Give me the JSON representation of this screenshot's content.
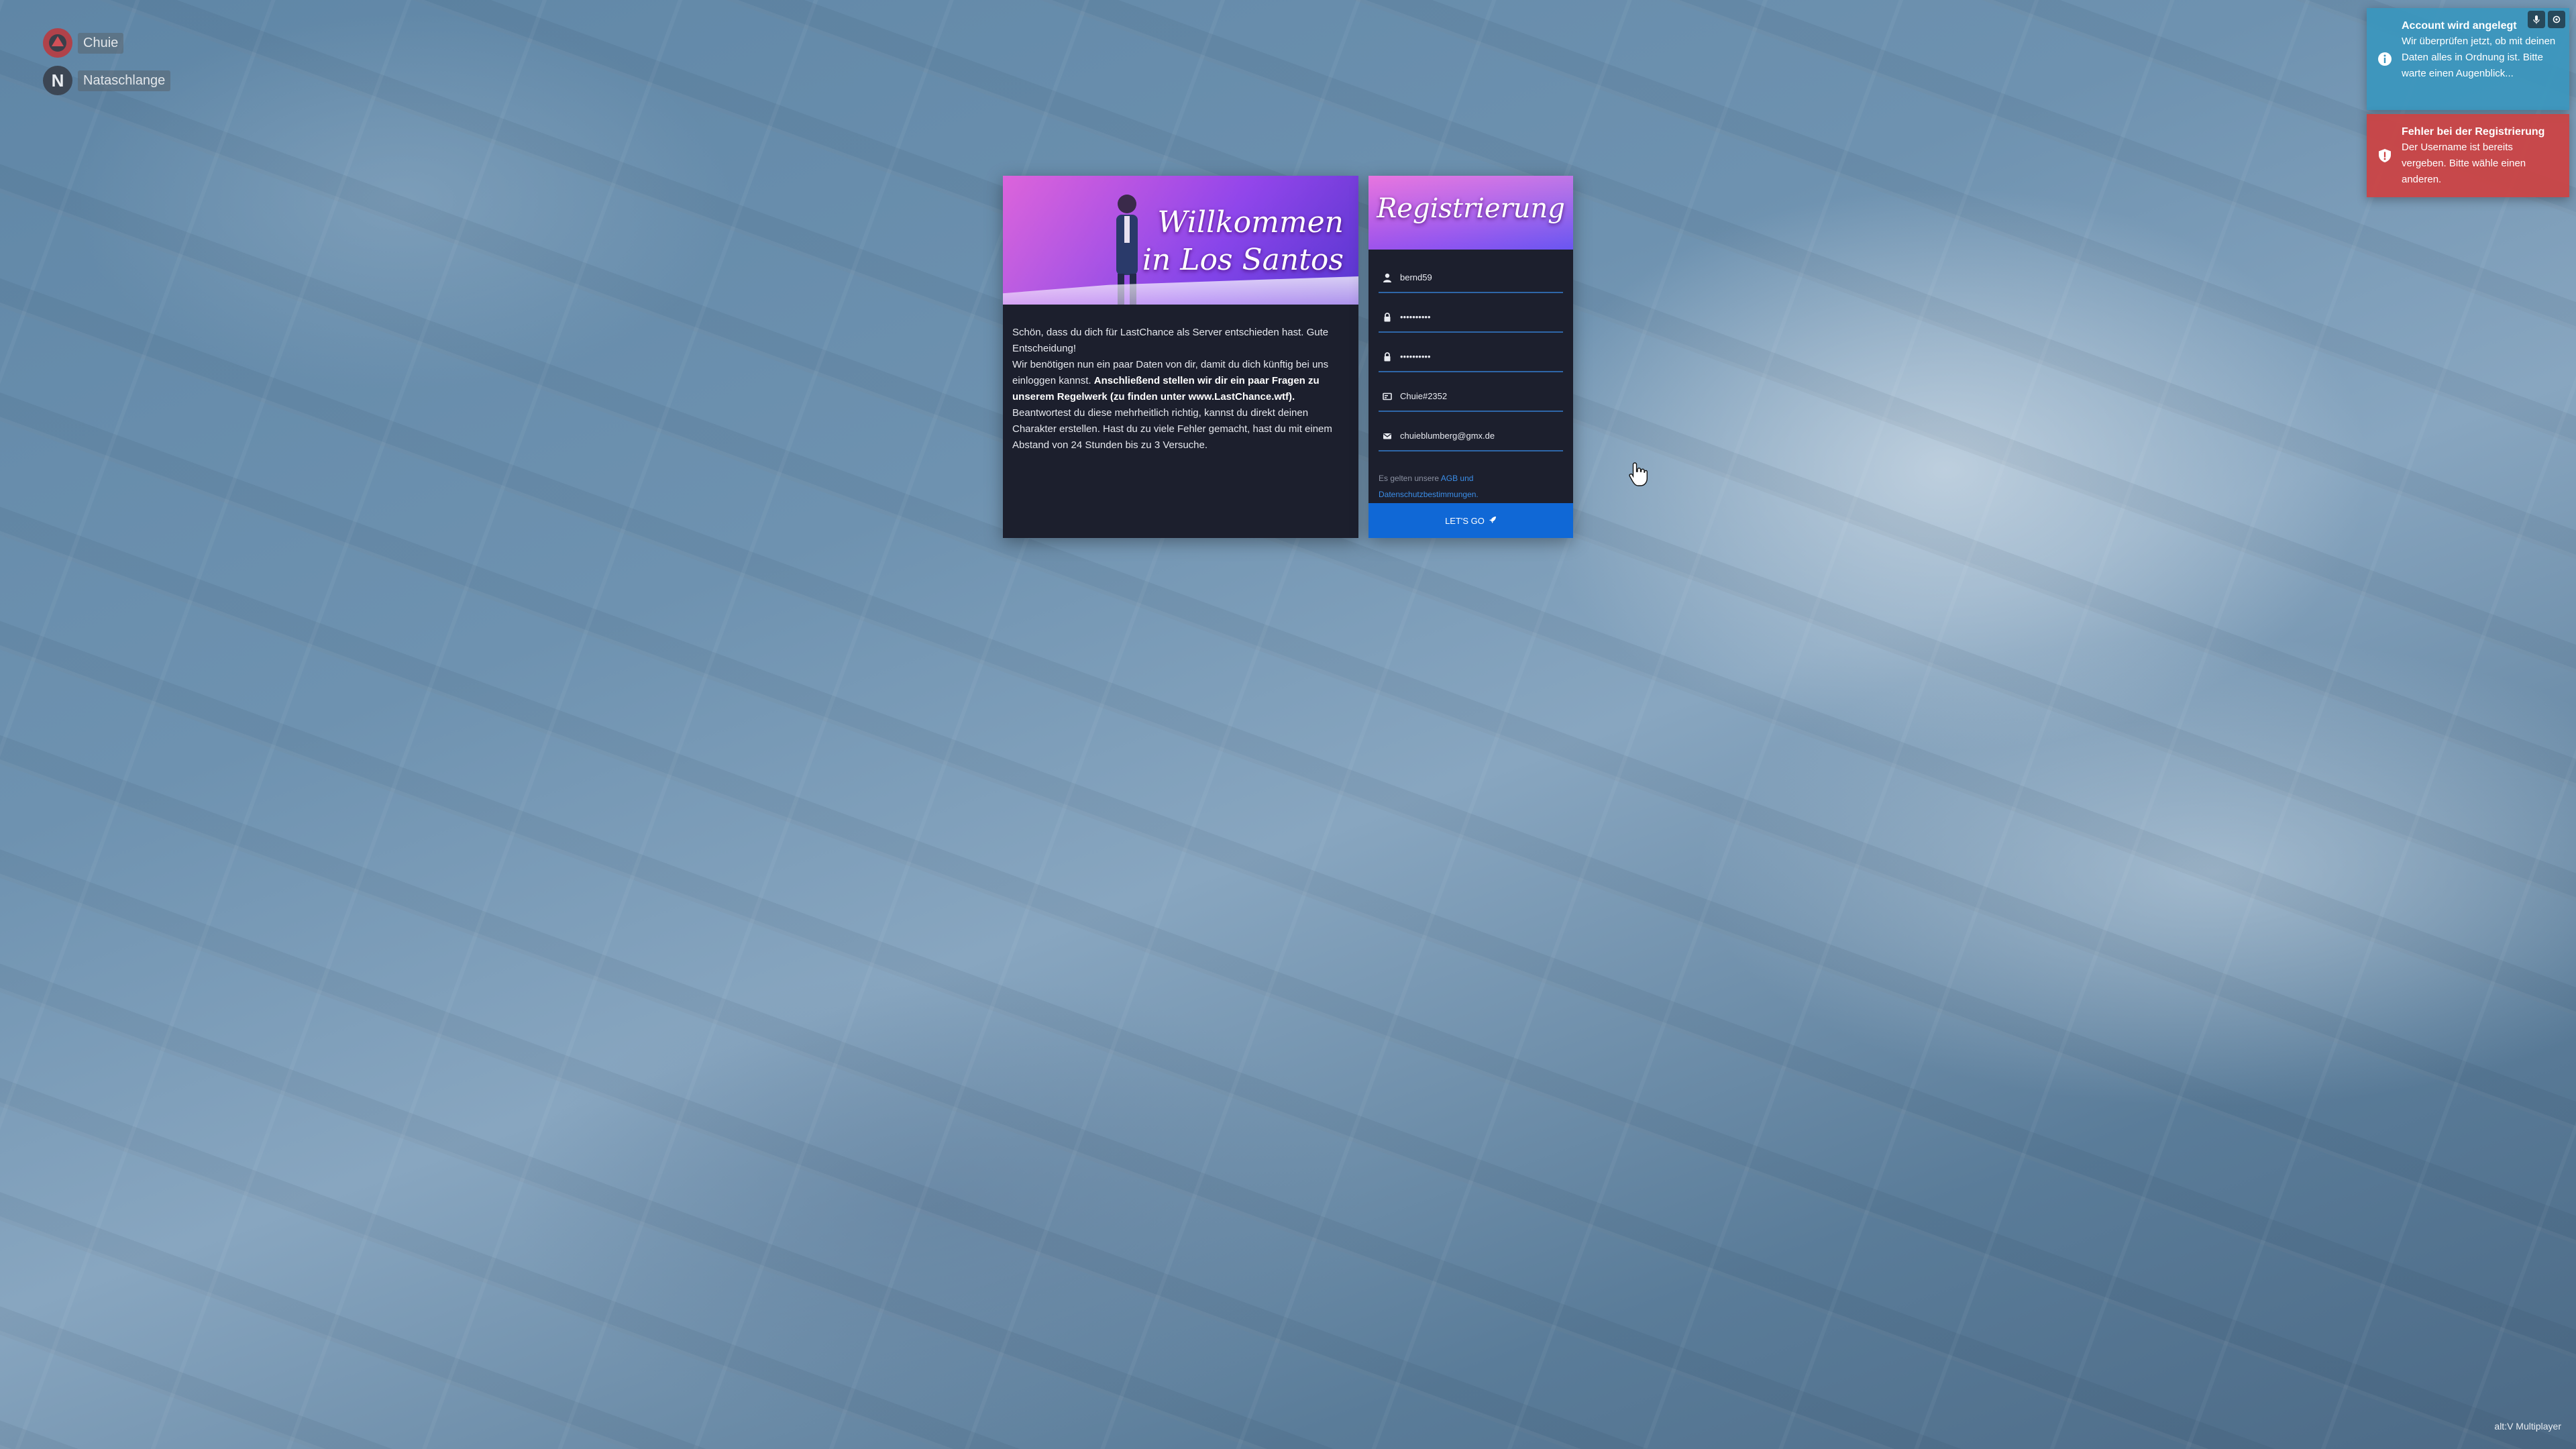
{
  "players": [
    {
      "name": "Chuie",
      "avatar_color": "#b0424a",
      "avatar_letter": ""
    },
    {
      "name": "Nataschlange",
      "avatar_color": "#3c4654",
      "avatar_letter": "N"
    }
  ],
  "welcome": {
    "banner_title_line1": "Willkommen",
    "banner_title_line2": "in Los Santos",
    "text_part1": "Schön, dass du dich für LastChance als Server entschieden hast. Gute Entscheidung!",
    "text_part2": "Wir benötigen nun ein paar Daten von dir, damit du dich künftig bei uns einloggen kannst. ",
    "text_bold": "Anschließend stellen wir dir ein paar Fragen zu unserem Regelwerk (zu finden unter www.LastChance.wtf).",
    "text_part3": " Beantwortest du diese mehrheitlich richtig, kannst du direkt deinen Charakter erstellen. Hast du zu viele Fehler gemacht, hast du mit einem Abstand von 24 Stunden bis zu 3 Versuche."
  },
  "registration": {
    "banner_title": "Registrierung",
    "fields": {
      "username": "bernd59",
      "password": "••••••••••",
      "password_confirm": "••••••••••",
      "social_club": "Chuie#2352",
      "email": "chuieblumberg@gmx.de"
    },
    "terms_prefix": "Es gelten unsere ",
    "terms_link": "AGB und Datenschutzbestimmungen.",
    "submit_label": "LET'S GO"
  },
  "notifications": [
    {
      "type": "info",
      "title": "Account wird angelegt",
      "message": "Wir überprüfen jetzt, ob mit deinen Daten alles in Ordnung ist. Bitte warte einen Augenblick..."
    },
    {
      "type": "error",
      "title": "Fehler bei der Registrierung",
      "message": "Der Username ist bereits vergeben. Bitte wähle einen anderen."
    }
  ],
  "watermark": "alt:V Multiplayer",
  "colors": {
    "card_bg": "#1c1f2d",
    "accent_blue": "#1068d6",
    "info": "#3896be",
    "error": "#cd4141"
  }
}
